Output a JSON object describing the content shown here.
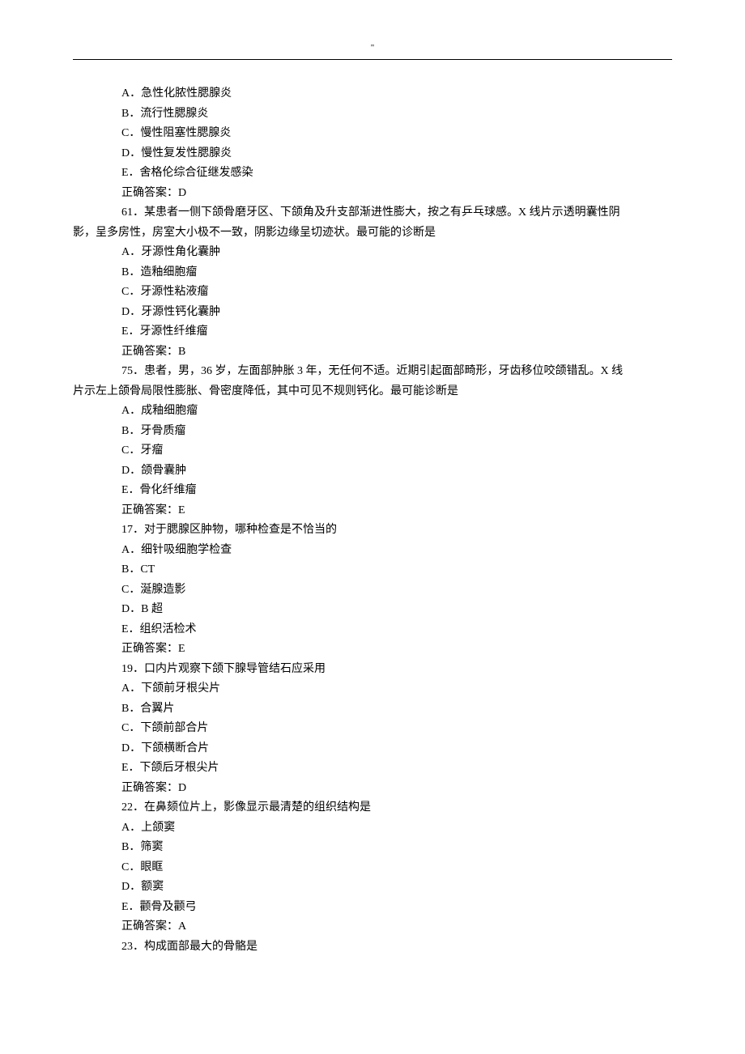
{
  "header_mark": "\"",
  "q60": {
    "opt_a": "A．急性化脓性腮腺炎",
    "opt_b": "B．流行性腮腺炎",
    "opt_c": "C．慢性阻塞性腮腺炎",
    "opt_d": "D．慢性复发性腮腺炎",
    "opt_e": "E．舍格伦综合征继发感染",
    "answer": "正确答案：D"
  },
  "q61": {
    "stem_line1": "61．某患者一侧下颌骨磨牙区、下颌角及升支部渐进性膨大，按之有乒乓球感。X 线片示透明囊性阴",
    "stem_line2": "影，呈多房性，房室大小极不一致，阴影边缘呈切迹状。最可能的诊断是",
    "opt_a": "A．牙源性角化囊肿",
    "opt_b": "B．造釉细胞瘤",
    "opt_c": "C．牙源性粘液瘤",
    "opt_d": "D．牙源性钙化囊肿",
    "opt_e": "E．牙源性纤维瘤",
    "answer": "正确答案：B"
  },
  "q75": {
    "stem_line1": "75．患者，男，36 岁，左面部肿胀 3 年，无任何不适。近期引起面部畸形，牙齿移位咬颌错乱。X 线",
    "stem_line2": "片示左上颌骨局限性膨胀、骨密度降低，其中可见不规则钙化。最可能诊断是",
    "opt_a": "A．成釉细胞瘤",
    "opt_b": "B．牙骨质瘤",
    "opt_c": "C．牙瘤",
    "opt_d": "D．颌骨囊肿",
    "opt_e": "E．骨化纤维瘤",
    "answer": "正确答案：E"
  },
  "q17": {
    "stem": "17．对于腮腺区肿物，哪种检查是不恰当的",
    "opt_a": "A．细针吸细胞学检查",
    "opt_b": "B．CT",
    "opt_c": "C．涎腺造影",
    "opt_d": "D．B 超",
    "opt_e": "E．组织活检术",
    "answer": "正确答案：E"
  },
  "q19": {
    "stem": "19．口内片观察下颌下腺导管结石应采用",
    "opt_a": "A．下颌前牙根尖片",
    "opt_b": "B．合翼片",
    "opt_c": "C．下颌前部合片",
    "opt_d": "D．下颌横断合片",
    "opt_e": "E．下颌后牙根尖片",
    "answer": "正确答案：D"
  },
  "q22": {
    "stem": "22．在鼻颏位片上，影像显示最清楚的组织结构是",
    "opt_a": "A．上颌窦",
    "opt_b": "B．筛窦",
    "opt_c": "C．眼眶",
    "opt_d": "D．额窦",
    "opt_e": "E．颧骨及颧弓",
    "answer": "正确答案：A"
  },
  "q23": {
    "stem": "23．构成面部最大的骨骼是"
  }
}
